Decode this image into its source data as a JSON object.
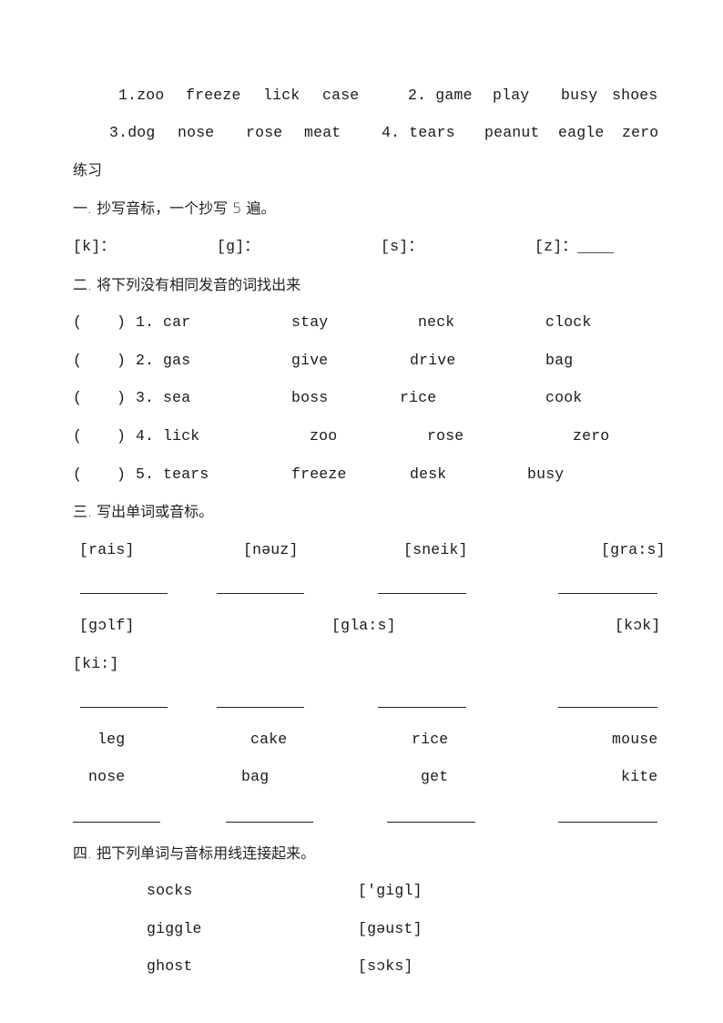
{
  "intro": {
    "row1": {
      "group1": {
        "label": "1.zoo",
        "words": [
          "freeze",
          "lick",
          "case"
        ]
      },
      "group2": {
        "label": "2. game",
        "words": [
          "play",
          "busy",
          "shoes"
        ]
      }
    },
    "row2": {
      "group3": {
        "label": "3.dog",
        "words": [
          "nose",
          "rose",
          "meat"
        ]
      },
      "group4": {
        "label": "4. tears",
        "words": [
          "peanut",
          "eagle",
          "zero"
        ]
      }
    }
  },
  "practice_heading": "练习",
  "section1": {
    "title": "一. 抄写音标，一个抄写 5 遍。",
    "items": [
      "[k]：",
      "[g]：",
      "[s]：",
      "[z]："
    ],
    "trailing_blank": "____"
  },
  "section2": {
    "title": "二. 将下列没有相同发音的词找出来",
    "paren_open": "(",
    "paren_close": ")",
    "rows": [
      {
        "num": "1.",
        "words": [
          "car",
          "stay",
          "neck",
          "clock"
        ]
      },
      {
        "num": "2.",
        "words": [
          "gas",
          "give",
          "drive",
          "bag"
        ]
      },
      {
        "num": "3.",
        "words": [
          "sea",
          "boss",
          "rice",
          "cook"
        ]
      },
      {
        "num": "4.",
        "words": [
          "lick",
          "zoo",
          "rose",
          "zero"
        ]
      },
      {
        "num": "5.",
        "words": [
          "tears",
          "freeze",
          "desk",
          "busy"
        ]
      }
    ]
  },
  "section3": {
    "title": "三. 写出单词或音标。",
    "phonetics_row1": [
      "[rais]",
      "[nəuz]",
      "[sneik]",
      "[gra:s]"
    ],
    "phonetics_row2": [
      "[gɔlf]",
      "[gla:s]",
      "[kɔk]"
    ],
    "phonetics_row3": [
      "[ki:]"
    ],
    "words_row1": [
      "leg",
      "cake",
      "rice",
      "mouse"
    ],
    "words_row2": [
      "nose",
      "bag",
      "get",
      "kite"
    ]
  },
  "section4": {
    "title": "四. 把下列单词与音标用线连接起来。",
    "words": [
      "socks",
      "giggle",
      "ghost"
    ],
    "phonetics": [
      "['gigl]",
      "[gəust]",
      "[sɔks]"
    ]
  }
}
